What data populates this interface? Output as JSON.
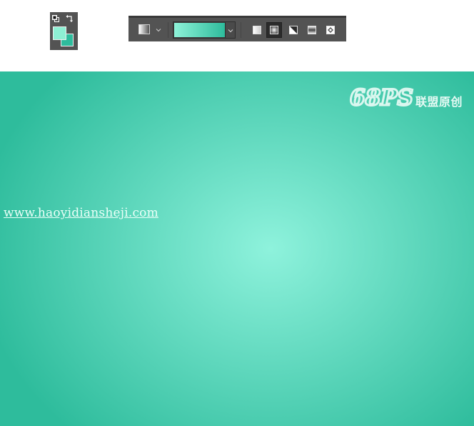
{
  "swatches": {
    "foreground_color": "#8ef0d4",
    "background_color": "#2ebc9c",
    "default_colors_icon": "default-colors-icon",
    "swap_icon": "swap-colors-icon"
  },
  "options_bar": {
    "preset_icon": "gradient-preset-icon",
    "gradient_start": "#8ef2d8",
    "gradient_end": "#2ebc9c",
    "gradient_types": [
      {
        "name": "linear-gradient-icon",
        "active": false
      },
      {
        "name": "radial-gradient-icon",
        "active": true
      },
      {
        "name": "angle-gradient-icon",
        "active": false
      },
      {
        "name": "reflected-gradient-icon",
        "active": false
      },
      {
        "name": "diamond-gradient-icon",
        "active": false
      }
    ]
  },
  "canvas": {
    "center_color": "#8ef2dc",
    "edge_color": "#2ebc9c",
    "watermark_url": "www.haoyidiansheji.com",
    "logo_brand": "68PS",
    "logo_caption": "联盟原创"
  }
}
